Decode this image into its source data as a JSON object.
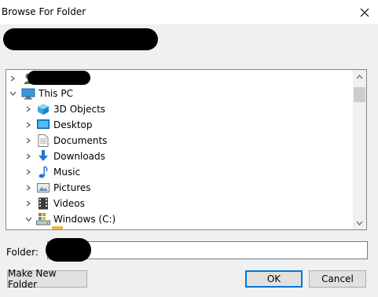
{
  "window": {
    "title": "Browse For Folder",
    "close_icon": "close-icon"
  },
  "tree": {
    "items": [
      {
        "label": "",
        "icon": "user-icon",
        "expanded": false,
        "level": 0
      },
      {
        "label": "This PC",
        "icon": "computer-icon",
        "expanded": true,
        "level": 0
      },
      {
        "label": "3D Objects",
        "icon": "cube-icon",
        "expanded": false,
        "level": 1
      },
      {
        "label": "Desktop",
        "icon": "desktop-icon",
        "expanded": false,
        "level": 1
      },
      {
        "label": "Documents",
        "icon": "document-icon",
        "expanded": false,
        "level": 1
      },
      {
        "label": "Downloads",
        "icon": "download-icon",
        "expanded": false,
        "level": 1
      },
      {
        "label": "Music",
        "icon": "music-icon",
        "expanded": false,
        "level": 1
      },
      {
        "label": "Pictures",
        "icon": "pictures-icon",
        "expanded": false,
        "level": 1
      },
      {
        "label": "Videos",
        "icon": "videos-icon",
        "expanded": false,
        "level": 1
      },
      {
        "label": "Windows (C:)",
        "icon": "drive-icon",
        "expanded": true,
        "level": 1
      }
    ]
  },
  "folder": {
    "label": "Folder:",
    "value": ""
  },
  "buttons": {
    "make_new_folder": "Make New Folder",
    "ok": "OK",
    "cancel": "Cancel"
  },
  "colors": {
    "accent": "#0078d7",
    "dialog_bg": "#f0f0f0"
  }
}
